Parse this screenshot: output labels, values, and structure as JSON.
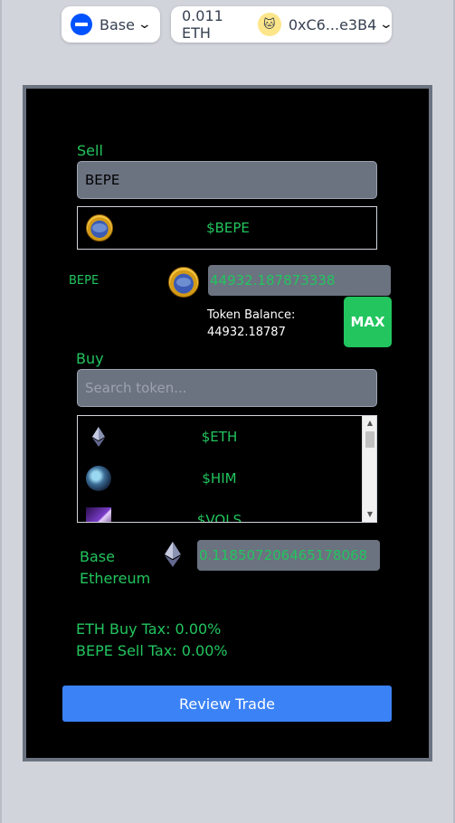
{
  "header": {
    "chain": {
      "label": "Base",
      "icon": "base-chain-icon"
    },
    "wallet": {
      "balance": "0.011 ETH",
      "address": "0xC6...e3B4",
      "avatar_icon": "cat-avatar-icon"
    }
  },
  "sell": {
    "label": "Sell",
    "search_value": "BEPE",
    "selected_token": "$BEPE",
    "token_name": "BEPE",
    "amount": "44932.187873338",
    "balance_label": "Token Balance:",
    "balance_value": "44932.18787",
    "max_label": "MAX"
  },
  "buy": {
    "label": "Buy",
    "search_placeholder": "Search token...",
    "tokens": [
      {
        "symbol": "$ETH",
        "icon": "ethereum-icon"
      },
      {
        "symbol": "$HIM",
        "icon": "him-token-icon"
      },
      {
        "symbol": "$VOLS",
        "icon": "vols-token-icon"
      }
    ],
    "token_name_line1": "Base",
    "token_name_line2": "Ethereum",
    "amount": "0.118507206465178068"
  },
  "taxes": {
    "buy_tax": "ETH Buy Tax: 0.00%",
    "sell_tax": "BEPE Sell Tax: 0.00%"
  },
  "review_label": "Review Trade",
  "colors": {
    "accent_green": "#22c55e",
    "button_blue": "#3b82f6",
    "input_gray": "#6b7280",
    "card_bg": "#000000"
  }
}
